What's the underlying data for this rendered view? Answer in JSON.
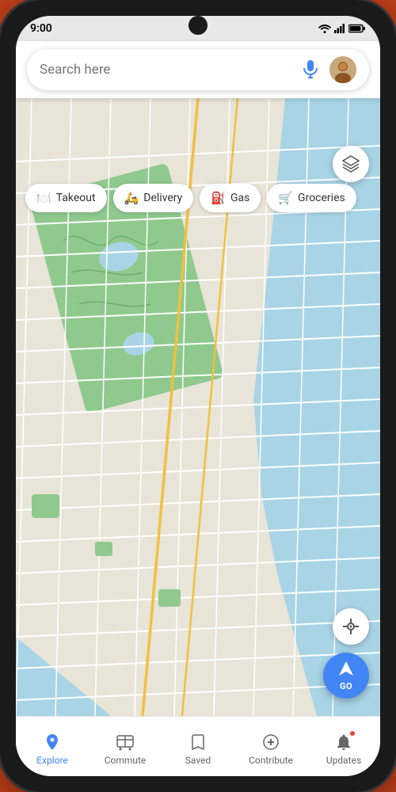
{
  "status_bar": {
    "time": "9:00"
  },
  "search": {
    "placeholder": "Search here"
  },
  "categories": [
    {
      "id": "takeout",
      "label": "Takeout",
      "icon": "🍽️"
    },
    {
      "id": "delivery",
      "label": "Delivery",
      "icon": "🛵"
    },
    {
      "id": "gas",
      "label": "Gas",
      "icon": "⛽"
    },
    {
      "id": "groceries",
      "label": "Groceries",
      "icon": "🛒"
    }
  ],
  "map": {
    "layers_tooltip": "Layers",
    "locate_tooltip": "My location"
  },
  "go_button": {
    "label": "GO"
  },
  "bottom_nav": [
    {
      "id": "explore",
      "label": "Explore",
      "active": true
    },
    {
      "id": "commute",
      "label": "Commute",
      "active": false
    },
    {
      "id": "saved",
      "label": "Saved",
      "active": false
    },
    {
      "id": "contribute",
      "label": "Contribute",
      "active": false
    },
    {
      "id": "updates",
      "label": "Updates",
      "active": false,
      "badge": true
    }
  ],
  "colors": {
    "accent": "#4285f4",
    "park": "#8fc98e",
    "water": "#a8d4e6",
    "road_major": "#f0c040",
    "road_minor": "#ffffff",
    "grid": "#d6d0c4",
    "land": "#e8e4d8"
  }
}
